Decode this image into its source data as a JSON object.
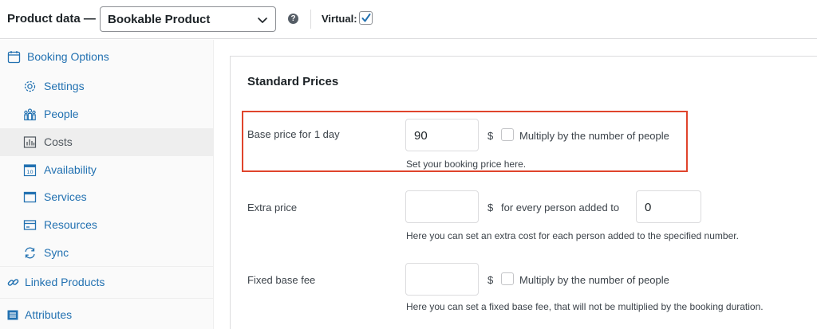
{
  "header": {
    "title": "Product data —",
    "product_type": "Bookable Product",
    "help_icon": "question-circle-icon",
    "virtual_label": "Virtual:",
    "virtual_checked": true
  },
  "sidebar": {
    "items": [
      {
        "label": "Booking Options",
        "icon": "calendar-icon",
        "sub": false
      },
      {
        "label": "Settings",
        "icon": "gear-icon",
        "sub": true
      },
      {
        "label": "People",
        "icon": "people-icon",
        "sub": true
      },
      {
        "label": "Costs",
        "icon": "chart-icon",
        "sub": true,
        "active": true
      },
      {
        "label": "Availability",
        "icon": "calendar-10-icon",
        "sub": true
      },
      {
        "label": "Services",
        "icon": "window-icon",
        "sub": true
      },
      {
        "label": "Resources",
        "icon": "card-icon",
        "sub": true
      },
      {
        "label": "Sync",
        "icon": "sync-icon",
        "sub": true
      },
      {
        "label": "Linked Products",
        "icon": "link-icon",
        "sub": false
      },
      {
        "label": "Attributes",
        "icon": "list-icon",
        "sub": false
      }
    ]
  },
  "main": {
    "section_title": "Standard Prices",
    "base_price": {
      "label": "Base price for 1 day",
      "value": "90",
      "currency": "$",
      "checkbox_label": "Multiply by the number of people",
      "checked": false,
      "help": "Set your booking price here."
    },
    "extra_price": {
      "label": "Extra price",
      "value": "",
      "currency": "$",
      "between_text": "for every person added to",
      "count_value": "0",
      "help": "Here you can set an extra cost for each person added to the specified number."
    },
    "fixed_fee": {
      "label": "Fixed base fee",
      "value": "",
      "currency": "$",
      "checkbox_label": "Multiply by the number of people",
      "checked": false,
      "help": "Here you can set a fixed base fee, that will not be multiplied by the booking duration."
    }
  },
  "colors": {
    "accent": "#2271b1",
    "highlight": "#e0442c"
  }
}
